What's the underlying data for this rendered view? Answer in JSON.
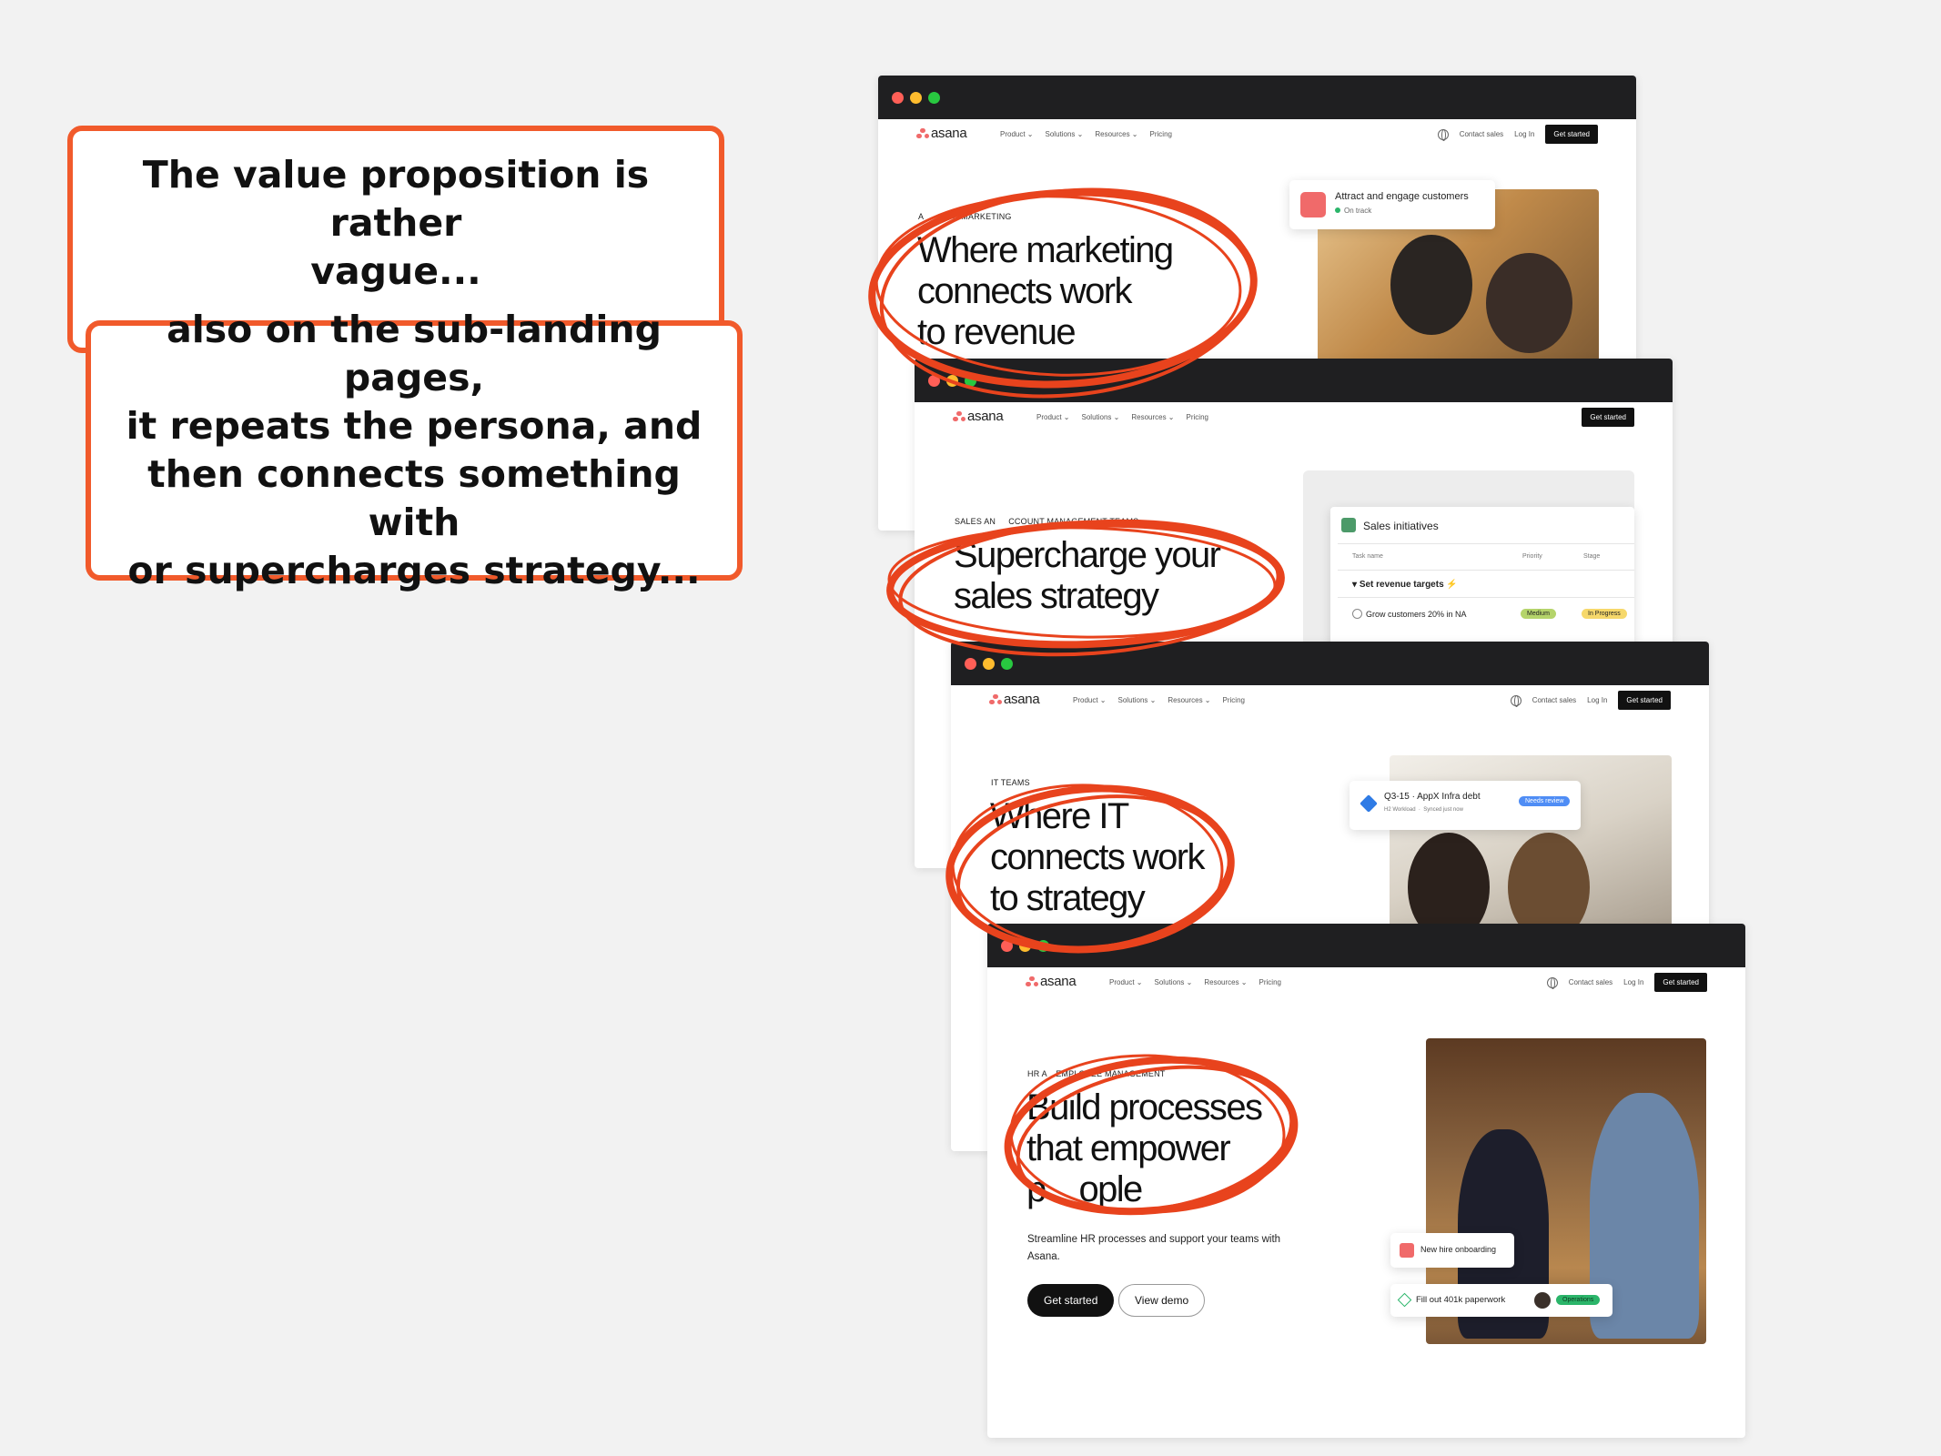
{
  "callouts": {
    "first": [
      "The value proposition is rather",
      "vague..."
    ],
    "second": [
      "also on the sub-landing pages,",
      "it repeats the persona, and",
      "then connects something with",
      "or supercharges strategy..."
    ]
  },
  "nav": {
    "brand": "asana",
    "menu": [
      "Product ⌄",
      "Solutions ⌄",
      "Resources ⌄",
      "Pricing"
    ],
    "contact_sales": "Contact sales",
    "log_in": "Log In",
    "get_started": "Get started"
  },
  "windows": [
    {
      "eyebrow": "ASANA FOR MARKETING",
      "eyebrow_visible": "A    FOR MARKETING",
      "headline": [
        "Where marketing",
        "connects work",
        "to revenue"
      ],
      "card": {
        "title": "Attract and engage customers",
        "status": "On track"
      }
    },
    {
      "eyebrow": "SALES AND ACCOUNT MANAGEMENT TEAMS",
      "eyebrow_visible": "SALES AN   CCOUNT MANAGEMENT TEAMS",
      "headline": [
        "Supercharge your",
        "sales strategy"
      ],
      "panel": {
        "title": "Sales initiatives",
        "columns": [
          "Task name",
          "Priority",
          "Stage"
        ],
        "section": "Set revenue targets",
        "row": {
          "task": "Grow customers 20% in NA",
          "priority": "Medium",
          "stage": "In Progress"
        }
      }
    },
    {
      "eyebrow": "IT TEAMS",
      "headline": [
        "Where IT",
        "connects work",
        "to strategy"
      ],
      "card": {
        "title": "Q3-15 · AppX Infra debt",
        "meta1": "H2 Workload",
        "meta2": "Synced just now",
        "badge": "Needs review"
      }
    },
    {
      "eyebrow": "HR AND EMPLOYEE MANAGEMENT",
      "eyebrow_visible": "HR A  EMPLOYEE MANAGEMENT",
      "headline": [
        "Build processes",
        "that empower",
        "people"
      ],
      "headline_last_visible": "p  ople",
      "subtext": [
        "Streamline HR processes and support your teams with",
        "Asana."
      ],
      "cta_primary": "Get started",
      "cta_secondary": "View demo",
      "card1": "New hire onboarding",
      "card2": {
        "task": "Fill out 401k paperwork",
        "tag": "Operations"
      }
    }
  ],
  "colors": {
    "accent": "#f15a2b",
    "asana_coral": "#f06a6a",
    "chrome": "#1f1f21"
  }
}
